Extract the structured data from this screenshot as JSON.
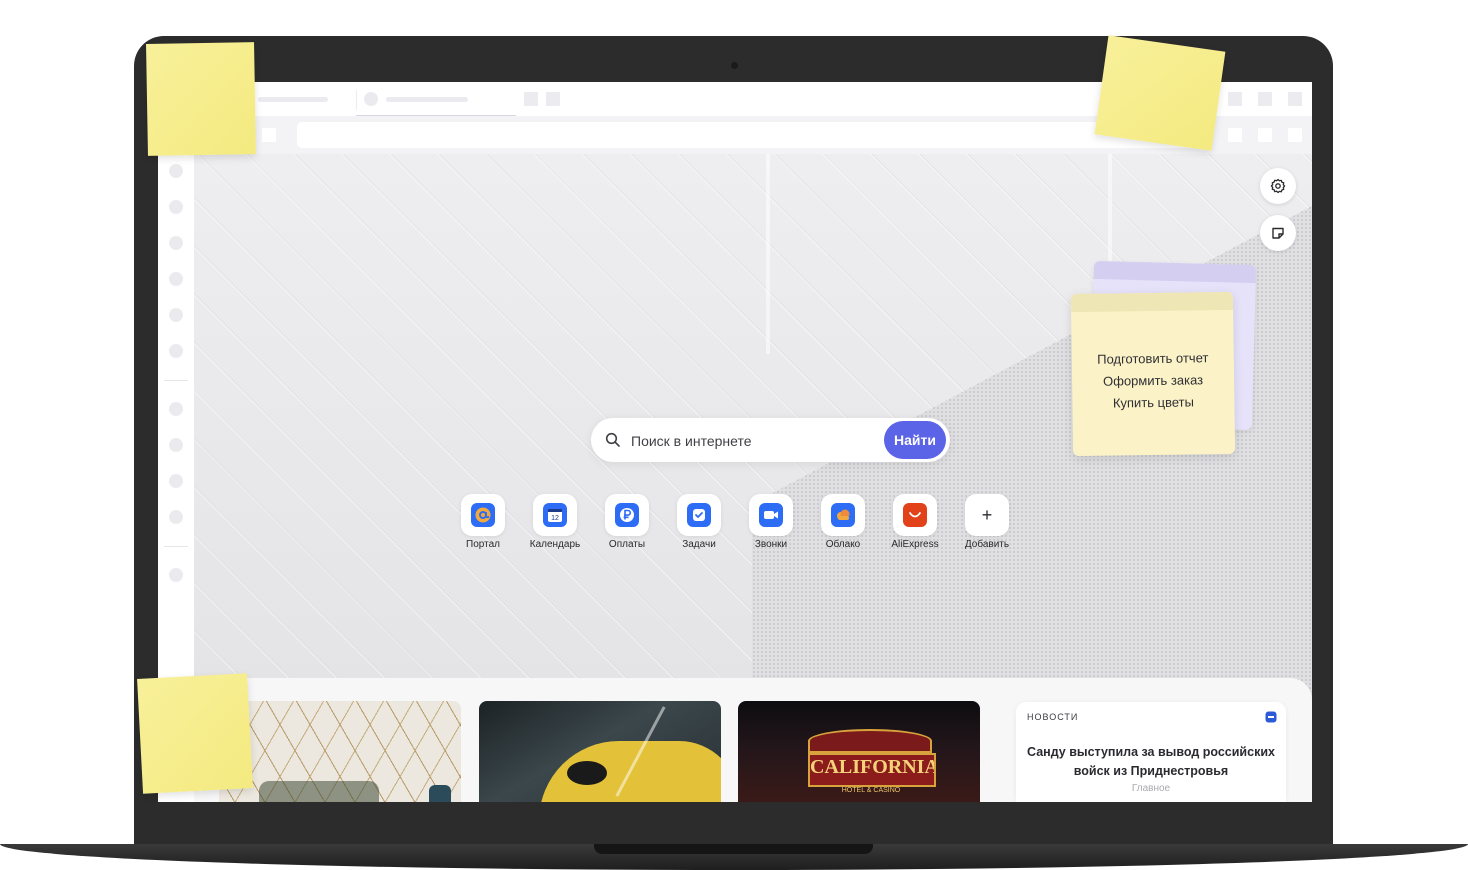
{
  "search": {
    "placeholder": "Поиск в интернете",
    "button_label": "Найти"
  },
  "shortcuts": [
    {
      "label": "Портал",
      "icon": "mail-portal-icon",
      "color": "#2d6df6"
    },
    {
      "label": "Календарь",
      "icon": "calendar-icon",
      "color": "#2d6df6",
      "day": "12"
    },
    {
      "label": "Оплаты",
      "icon": "ruble-payment-icon",
      "color": "#2d6df6"
    },
    {
      "label": "Задачи",
      "icon": "task-check-icon",
      "color": "#2d6df6"
    },
    {
      "label": "Звонки",
      "icon": "video-call-icon",
      "color": "#2d6df6"
    },
    {
      "label": "Облако",
      "icon": "cloud-icon",
      "color": "#2d6df6"
    },
    {
      "label": "AliExpress",
      "icon": "aliexpress-icon",
      "color": "#e2421a"
    },
    {
      "label": "Добавить",
      "icon": "plus-icon",
      "symbol": "+"
    }
  ],
  "note": {
    "lines": [
      "Подготовить отчет",
      "Оформить заказ",
      "Купить цветы"
    ]
  },
  "news": {
    "label": "НОВОСТИ",
    "headline": "Санду выступила за вывод российских войск из Приднестровья",
    "category": "Главное"
  },
  "card3": {
    "sign_text": "CALIFORNIA",
    "sign_subtext": "HOTEL & CASINO"
  },
  "colors": {
    "accent": "#5b63e6",
    "sticky_note": "#fbf3c7",
    "laptop": "#2c2c2c"
  }
}
